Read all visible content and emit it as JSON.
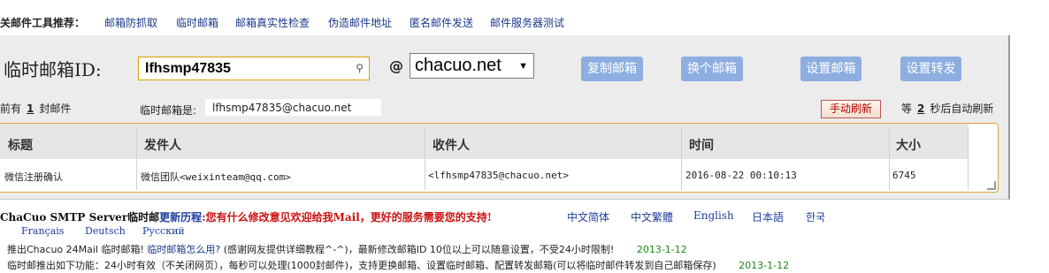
{
  "topnav": {
    "lead": "关邮件工具推荐：",
    "links": [
      "邮箱防抓取",
      "临时邮箱",
      "邮箱真实性检查",
      "伪造邮件地址",
      "匿名邮件发送",
      "邮件服务器测试"
    ]
  },
  "form": {
    "title": "临时邮箱ID:",
    "mailbox_id": "lfhsmp47835",
    "key_icon": "key-icon",
    "at": "@",
    "domain": "chacuo.net",
    "buttons": [
      "复制邮箱",
      "换个邮箱",
      "设置邮箱",
      "设置转发"
    ]
  },
  "status": {
    "prefix": "前有",
    "count": "1",
    "suffix": "封邮件",
    "address_label": "临时邮箱是:",
    "address": "lfhsmp47835@chacuo.net",
    "refresh_label": "手动刷新",
    "wait_prefix": "等",
    "wait_seconds": "2",
    "wait_suffix": "秒后自动刷新"
  },
  "table": {
    "headers": [
      "标题",
      "发件人",
      "收件人",
      "时间",
      "大小"
    ],
    "rows": [
      {
        "subject": "微信注册确认",
        "from": "微信团队<weixinteam@qq.com>",
        "to": "<lfhsmp47835@chacuo.net>",
        "time": "2016-08-22 00:10:13",
        "size": "6745"
      }
    ]
  },
  "footer": {
    "line1_a": "ChaCuo SMTP Server临时邮",
    "line1_b": "更新历程",
    "line1_c": ":您有什么修改意见欢迎给我Mail，更好的服务需要您的支持!",
    "languages": [
      "中文简体",
      "中文繁體",
      "English",
      "日本語",
      "한국"
    ],
    "languages2": [
      "Français",
      "Deutsch",
      "Русский"
    ],
    "news": [
      {
        "a": "推出Chacuo 24Mail 临时邮箱!",
        "link": "临时邮箱怎么用?",
        "b": "(感谢网友提供详细教程^-^)，最新修改邮箱ID 10位以上可以随意设置，不受24小时限制!",
        "date": "2013-1-12"
      },
      {
        "a": "临时邮推出如下功能：24小时有效（不关闭网页），每秒可以处理(1000封邮件)，支持更换邮箱、设置临时邮箱、配置转发邮箱(可以将临时邮件转发到自己邮箱保存)",
        "link": "",
        "b": "",
        "date": "2013-1-12"
      }
    ]
  }
}
